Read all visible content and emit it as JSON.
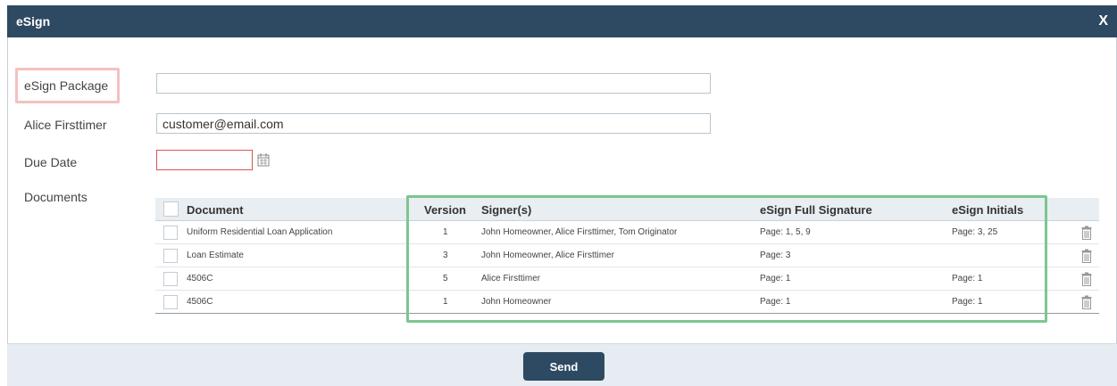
{
  "dialog": {
    "title": "eSign",
    "close_label": "X"
  },
  "form": {
    "package_label": "eSign Package",
    "package_value": "",
    "signer_label": "Alice Firsttimer",
    "email_value": "customer@email.com",
    "due_date_label": "Due Date",
    "due_date_value": "",
    "documents_label": "Documents"
  },
  "table": {
    "headers": {
      "document": "Document",
      "version": "Version",
      "signers": "Signer(s)",
      "full_signature": "eSign Full Signature",
      "initials": "eSign Initials"
    },
    "rows": [
      {
        "document": "Uniform Residential Loan Application",
        "version": "1",
        "signers": "John Homeowner, Alice Firsttimer, Tom Originator",
        "full_signature": "Page: 1, 5, 9",
        "initials": "Page: 3, 25"
      },
      {
        "document": "Loan Estimate",
        "version": "3",
        "signers": "John Homeowner, Alice Firsttimer",
        "full_signature": "Page: 3",
        "initials": ""
      },
      {
        "document": "4506C",
        "version": "5",
        "signers": "Alice Firsttimer",
        "full_signature": "Page: 1",
        "initials": "Page: 1"
      },
      {
        "document": "4506C",
        "version": "1",
        "signers": "John Homeowner",
        "full_signature": "Page: 1",
        "initials": "Page: 1"
      }
    ]
  },
  "footer": {
    "send_label": "Send"
  },
  "icons": {
    "calendar": "calendar-icon",
    "trash": "trash-icon"
  },
  "colors": {
    "header_bg": "#2e4a62",
    "highlight_red": "#f2c1c1",
    "highlight_green": "#7cc68f",
    "date_error_border": "#d9534f",
    "footer_bg": "#e6ecf1"
  }
}
